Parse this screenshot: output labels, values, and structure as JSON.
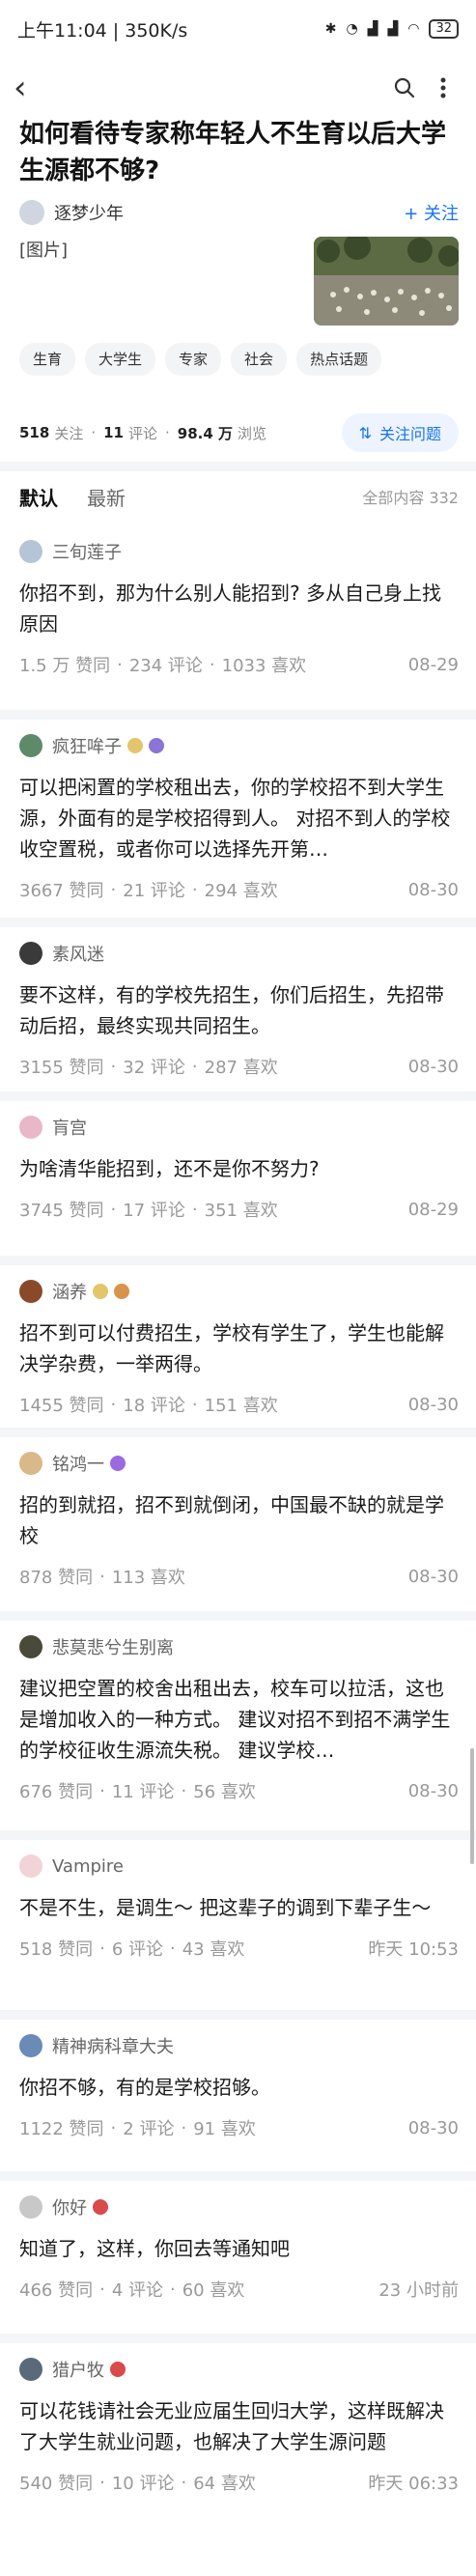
{
  "status": {
    "time": "上午11:04 | 350K/s",
    "battery": "32"
  },
  "topbar": {
    "back": "‹"
  },
  "question": {
    "title": "如何看待专家称年轻人不生育以后大学生源都不够?",
    "author": "逐梦少年",
    "follow_label": "+ 关注",
    "image_alt": "[图片]"
  },
  "tags": [
    "生育",
    "大学生",
    "专家",
    "社会",
    "热点话题"
  ],
  "stats": {
    "followers": "518",
    "followers_label": "关注",
    "comments": "11",
    "comments_label": "评论",
    "views": "98.4 万",
    "views_label": "浏览",
    "follow_q": "关注问题"
  },
  "sort": {
    "tab_default": "默认",
    "tab_latest": "最新",
    "total": "全部内容 332"
  },
  "answers": [
    {
      "author": "三旬莲子",
      "avatar_color": "#b6c4d8",
      "badges": [],
      "text": "你招不到，那为什么别人能招到? 多从自己身上找原因",
      "likes": "1.5 万 赞同",
      "comments": "234 评论",
      "favs": "1033 喜欢",
      "time": "08-29"
    },
    {
      "author": "疯狂哞子",
      "avatar_color": "#5e8a6a",
      "badges": [
        "#e3c66b",
        "#8a74d6"
      ],
      "text": "可以把闲置的学校租出去，你的学校招不到大学生源，外面有的是学校招得到人。 对招不到人的学校收空置税，或者你可以选择先开第…",
      "likes": "3667 赞同",
      "comments": "21 评论",
      "favs": "294 喜欢",
      "time": "08-30"
    },
    {
      "author": "素风迷",
      "avatar_color": "#3a3a3a",
      "badges": [],
      "text": "要不这样，有的学校先招生，你们后招生，先招带动后招，最终实现共同招生。",
      "likes": "3155 赞同",
      "comments": "32 评论",
      "favs": "287 喜欢",
      "time": "08-30"
    },
    {
      "author": "肓宫",
      "avatar_color": "#e9b8c8",
      "badges": [],
      "text": "为啥清华能招到，还不是你不努力?",
      "likes": "3745 赞同",
      "comments": "17 评论",
      "favs": "351 喜欢",
      "time": "08-29"
    },
    {
      "author": "涵养",
      "avatar_color": "#8a4a2a",
      "badges": [
        "#e3c66b",
        "#d9934a"
      ],
      "text": "招不到可以付费招生，学校有学生了，学生也能解决学杂费，一举两得。",
      "likes": "1455 赞同",
      "comments": "18 评论",
      "favs": "151 喜欢",
      "time": "08-30"
    },
    {
      "author": "铭鸿一",
      "avatar_color": "#d9b98a",
      "badges": [
        "#9b6ae0"
      ],
      "text": "招的到就招，招不到就倒闭，中国最不缺的就是学校",
      "likes": "878 赞同",
      "comments": "113 喜欢",
      "favs": "",
      "time": "08-30"
    },
    {
      "author": "悲莫悲兮生别离",
      "avatar_color": "#4a4a3a",
      "badges": [],
      "text": "建议把空置的校舍出租出去，校车可以拉活，这也是增加收入的一种方式。 建议对招不到招不满学生的学校征收生源流失税。 建议学校…",
      "likes": "676 赞同",
      "comments": "11 评论",
      "favs": "56 喜欢",
      "time": "08-30"
    },
    {
      "author": "Vampire",
      "avatar_color": "#f2d4d8",
      "badges": [],
      "text": "不是不生，是调生～ 把这辈子的调到下辈子生～",
      "likes": "518 赞同",
      "comments": "6 评论",
      "favs": "43 喜欢",
      "time": "昨天 10:53"
    },
    {
      "author": "精神病科章大夫",
      "avatar_color": "#6a8ab8",
      "badges": [],
      "text": "你招不够，有的是学校招够。",
      "likes": "1122 赞同",
      "comments": "2 评论",
      "favs": "91 喜欢",
      "time": "08-30"
    },
    {
      "author": "你好",
      "avatar_color": "#c8c8c8",
      "badges": [
        "#d94a4a"
      ],
      "text": "知道了，这样，你回去等通知吧",
      "likes": "466 赞同",
      "comments": "4 评论",
      "favs": "60 喜欢",
      "time": "23 小时前"
    },
    {
      "author": "猎户牧",
      "avatar_color": "#5a6a7a",
      "badges": [
        "#d94a4a"
      ],
      "text": "可以花钱请社会无业应届生回归大学，这样既解决了大学生就业问题，也解决了大学生源问题",
      "likes": "540 赞同",
      "comments": "10 评论",
      "favs": "64 喜欢",
      "time": "昨天 06:33"
    }
  ]
}
